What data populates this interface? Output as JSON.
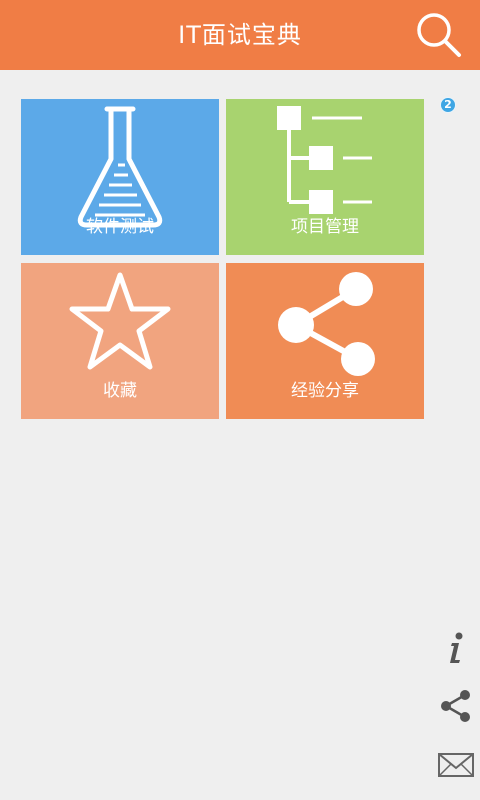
{
  "header": {
    "title": "IT面试宝典",
    "search_icon": "search-icon"
  },
  "badge": {
    "count": "2",
    "color": "#3fa6e4"
  },
  "tiles": [
    {
      "label": "软件测试",
      "icon": "flask-icon",
      "color": "#5ca9e8"
    },
    {
      "label": "项目管理",
      "icon": "tree-hierarchy-icon",
      "color": "#a8d36f"
    },
    {
      "label": "收藏",
      "icon": "star-icon",
      "color": "#f1a47f"
    },
    {
      "label": "经验分享",
      "icon": "share-icon",
      "color": "#f08c55"
    }
  ],
  "side_actions": [
    {
      "icon": "info-icon"
    },
    {
      "icon": "share-icon"
    },
    {
      "icon": "mail-icon"
    }
  ],
  "colors": {
    "accent": "#f07d45",
    "background": "#efefef"
  }
}
